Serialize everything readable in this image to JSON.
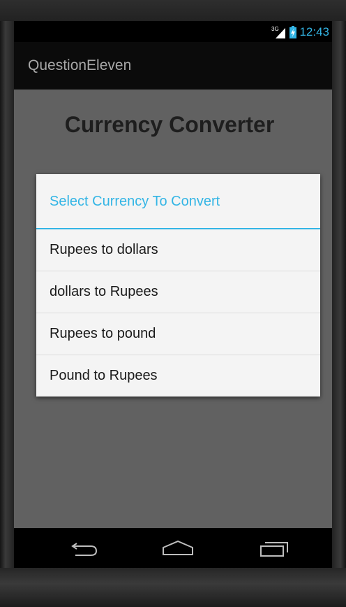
{
  "status_bar": {
    "network": "3G",
    "time": "12:43"
  },
  "action_bar": {
    "title": "QuestionEleven"
  },
  "main": {
    "heading": "Currency Converter"
  },
  "dialog": {
    "title": "Select Currency To Convert",
    "items": [
      {
        "label": "Rupees to dollars"
      },
      {
        "label": "dollars to Rupees"
      },
      {
        "label": "Rupees to pound"
      },
      {
        "label": "Pound to Rupees"
      }
    ]
  },
  "navigation": {
    "back_icon": "back-icon",
    "home_icon": "home-icon",
    "recents_icon": "recents-icon"
  },
  "colors": {
    "accent": "#33b5e5",
    "background": "#616161",
    "dialog_bg": "#f4f4f4"
  }
}
